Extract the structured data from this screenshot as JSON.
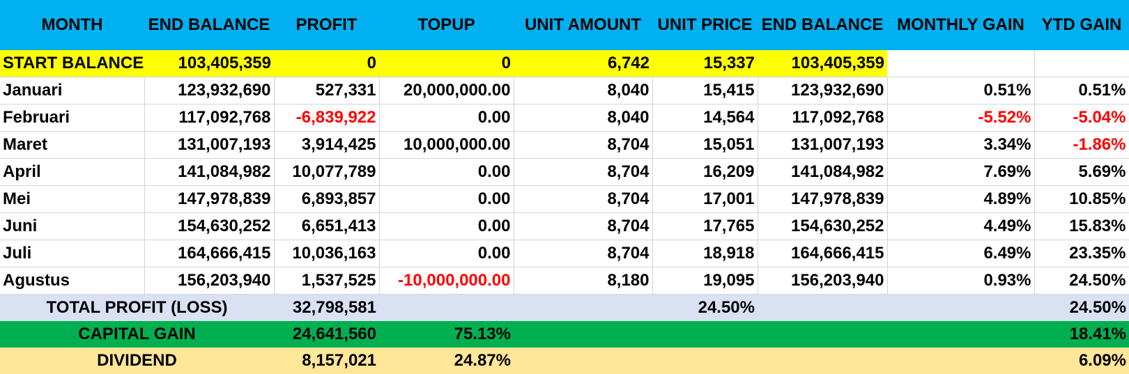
{
  "headers": [
    "MONTH",
    "END BALANCE",
    "PROFIT",
    "TOPUP",
    "UNIT AMOUNT",
    "UNIT PRICE",
    "END BALANCE",
    "MONTHLY GAIN",
    "YTD GAIN"
  ],
  "start": {
    "label": "START BALANCE",
    "end_balance": "103,405,359",
    "profit": "0",
    "topup": "0",
    "unit_amount": "6,742",
    "unit_price": "15,337",
    "end_balance2": "103,405,359"
  },
  "rows": [
    {
      "month": "Januari",
      "end_balance": "123,932,690",
      "profit": "527,331",
      "topup": "20,000,000.00",
      "unit_amount": "8,040",
      "unit_price": "15,415",
      "end_balance2": "123,932,690",
      "monthly_gain": "0.51%",
      "ytd_gain": "0.51%"
    },
    {
      "month": "Februari",
      "end_balance": "117,092,768",
      "profit": "-6,839,922",
      "topup": "0.00",
      "unit_amount": "8,040",
      "unit_price": "14,564",
      "end_balance2": "117,092,768",
      "monthly_gain": "-5.52%",
      "ytd_gain": "-5.04%"
    },
    {
      "month": "Maret",
      "end_balance": "131,007,193",
      "profit": "3,914,425",
      "topup": "10,000,000.00",
      "unit_amount": "8,704",
      "unit_price": "15,051",
      "end_balance2": "131,007,193",
      "monthly_gain": "3.34%",
      "ytd_gain": "-1.86%"
    },
    {
      "month": "April",
      "end_balance": "141,084,982",
      "profit": "10,077,789",
      "topup": "0.00",
      "unit_amount": "8,704",
      "unit_price": "16,209",
      "end_balance2": "141,084,982",
      "monthly_gain": "7.69%",
      "ytd_gain": "5.69%"
    },
    {
      "month": "Mei",
      "end_balance": "147,978,839",
      "profit": "6,893,857",
      "topup": "0.00",
      "unit_amount": "8,704",
      "unit_price": "17,001",
      "end_balance2": "147,978,839",
      "monthly_gain": "4.89%",
      "ytd_gain": "10.85%"
    },
    {
      "month": "Juni",
      "end_balance": "154,630,252",
      "profit": "6,651,413",
      "topup": "0.00",
      "unit_amount": "8,704",
      "unit_price": "17,765",
      "end_balance2": "154,630,252",
      "monthly_gain": "4.49%",
      "ytd_gain": "15.83%"
    },
    {
      "month": "Juli",
      "end_balance": "164,666,415",
      "profit": "10,036,163",
      "topup": "0.00",
      "unit_amount": "8,704",
      "unit_price": "18,918",
      "end_balance2": "164,666,415",
      "monthly_gain": "6.49%",
      "ytd_gain": "23.35%"
    },
    {
      "month": "Agustus",
      "end_balance": "156,203,940",
      "profit": "1,537,525",
      "topup": "-10,000,000.00",
      "unit_amount": "8,180",
      "unit_price": "19,095",
      "end_balance2": "156,203,940",
      "monthly_gain": "0.93%",
      "ytd_gain": "24.50%"
    }
  ],
  "summary": {
    "total": {
      "label": "TOTAL PROFIT (LOSS)",
      "profit": "32,798,581",
      "pct": "24.50%",
      "ytd": "24.50%"
    },
    "capital_gain": {
      "label": "CAPITAL GAIN",
      "value": "24,641,560",
      "share": "75.13%",
      "ytd": "18.41%"
    },
    "dividend": {
      "label": "DIVIDEND",
      "value": "8,157,021",
      "share": "24.87%",
      "ytd": "6.09%"
    }
  },
  "colors": {
    "header": "#00b0f0",
    "start_row": "#ffff00",
    "total_row": "#d9e1f2",
    "capital_row": "#00b050",
    "dividend_row": "#ffe699",
    "negative": "#ff0000"
  }
}
